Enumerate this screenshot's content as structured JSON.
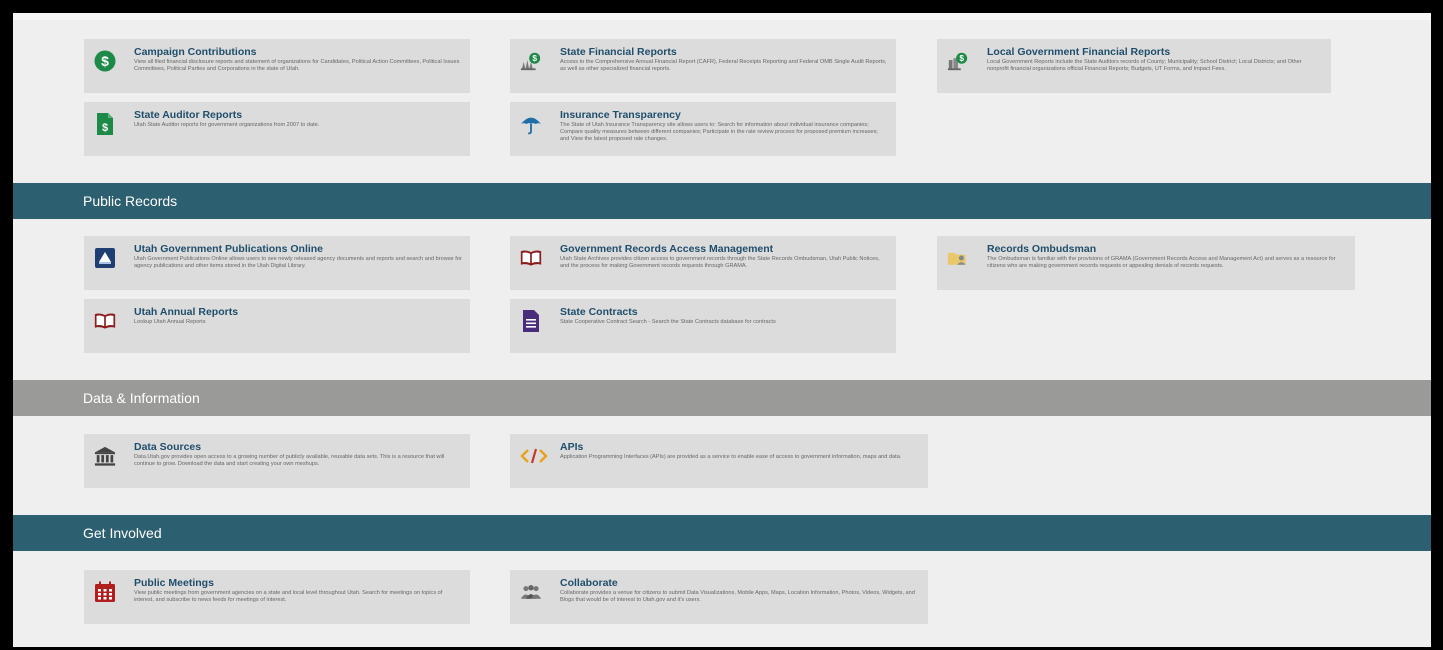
{
  "sections": {
    "public_records": "Public Records",
    "data_information": "Data & Information",
    "get_involved": "Get Involved"
  },
  "cards": {
    "campaign": {
      "title": "Campaign Contributions",
      "desc": "View all filed financial disclosure reports and statement of organizations for Candidates, Political Action Committees, Political Issues Committees, Political Parties and Corporations in the state of Utah.",
      "icon": "dollar-circle-icon"
    },
    "state_financial": {
      "title": "State Financial Reports",
      "desc": "Access to the Comprehensive Annual Financial Report (CAFR), Federal Receipts Reporting and Federal OMB Single Audit Reports, as well as other specialized financial reports.",
      "icon": "capitol-dollar-icon"
    },
    "local_gov": {
      "title": "Local Government Financial Reports",
      "desc": "Local Government Reports include the State Auditors records of County; Municipality; School District; Local Districts; and Other nonprofit financial organizations official Financial Reports; Budgets, UT Forms, and Impact Fees.",
      "icon": "building-dollar-icon"
    },
    "state_auditor": {
      "title": "State Auditor Reports",
      "desc": "Utah State Auditor reports for government organizations from 2007 to date.",
      "icon": "document-dollar-icon"
    },
    "insurance": {
      "title": "Insurance Transparency",
      "desc": "The State of Utah Insurance Transparency site allows users to: Search for information about individual insurance companies; Compare quality measures between different companies; Participate in the rate review process for proposed premium increases; and View the latest proposed rate changes.",
      "icon": "umbrella-icon"
    },
    "publications": {
      "title": "Utah Government Publications Online",
      "desc": "Utah Government Publications Online allows users to see newly released agency documents and reports and search and browse for agency publications and other items stored in the Utah Digital Library.",
      "icon": "publication-icon"
    },
    "grama": {
      "title": "Government Records Access Management",
      "desc": "Utah State Archives provides citizen access to government records through the State Records Ombudsman, Utah Public Notices, and the process for making Government records requests through GRAMA.",
      "icon": "open-book-icon"
    },
    "ombudsman": {
      "title": "Records Ombudsman",
      "desc": "The Ombudsman is familiar with the provisions of GRAMA (Government Records Access and Management Act) and serves as a resource for citizens who are making government records requests or appealing denials of records requests.",
      "icon": "folder-person-icon"
    },
    "annual": {
      "title": "Utah Annual Reports",
      "desc": "Lookup Utah Annual Reports",
      "icon": "open-book-icon"
    },
    "contracts": {
      "title": "State Contracts",
      "desc": "State Cooperative Contract Search - Search the State Contracts database for contracts",
      "icon": "document-lines-icon"
    },
    "data_sources": {
      "title": "Data Sources",
      "desc": "Data.Utah.gov provides open access to a growing number of publicly available, reusable data sets. This is a resource that will continue to grow. Download the data and start creating your own meshups.",
      "icon": "bank-columns-icon"
    },
    "apis": {
      "title": "APIs",
      "desc": "Application Programming Interfaces (APIs) are provided as a service to enable ease of access to government information, maps and data.",
      "icon": "code-brackets-icon"
    },
    "meetings": {
      "title": "Public Meetings",
      "desc": "View public meetings from government agencies on a state and local level throughout Utah. Search for meetings on topics of interest, and subscribe to news feeds for meetings of interest.",
      "icon": "calendar-icon"
    },
    "collaborate": {
      "title": "Collaborate",
      "desc": "Collaborate provides a venue for citizens to submit Data Visualizations, Mobile Apps, Maps, Location Information, Photos, Videos, Widgets, and Blogs that would be of interest to Utah.gov and it's users.",
      "icon": "people-group-icon"
    }
  },
  "colors": {
    "teal_header": "#2c5f70",
    "gray_header": "#9a9a98",
    "card_bg": "#dcdcdc",
    "title_blue": "#1f4e6c"
  }
}
